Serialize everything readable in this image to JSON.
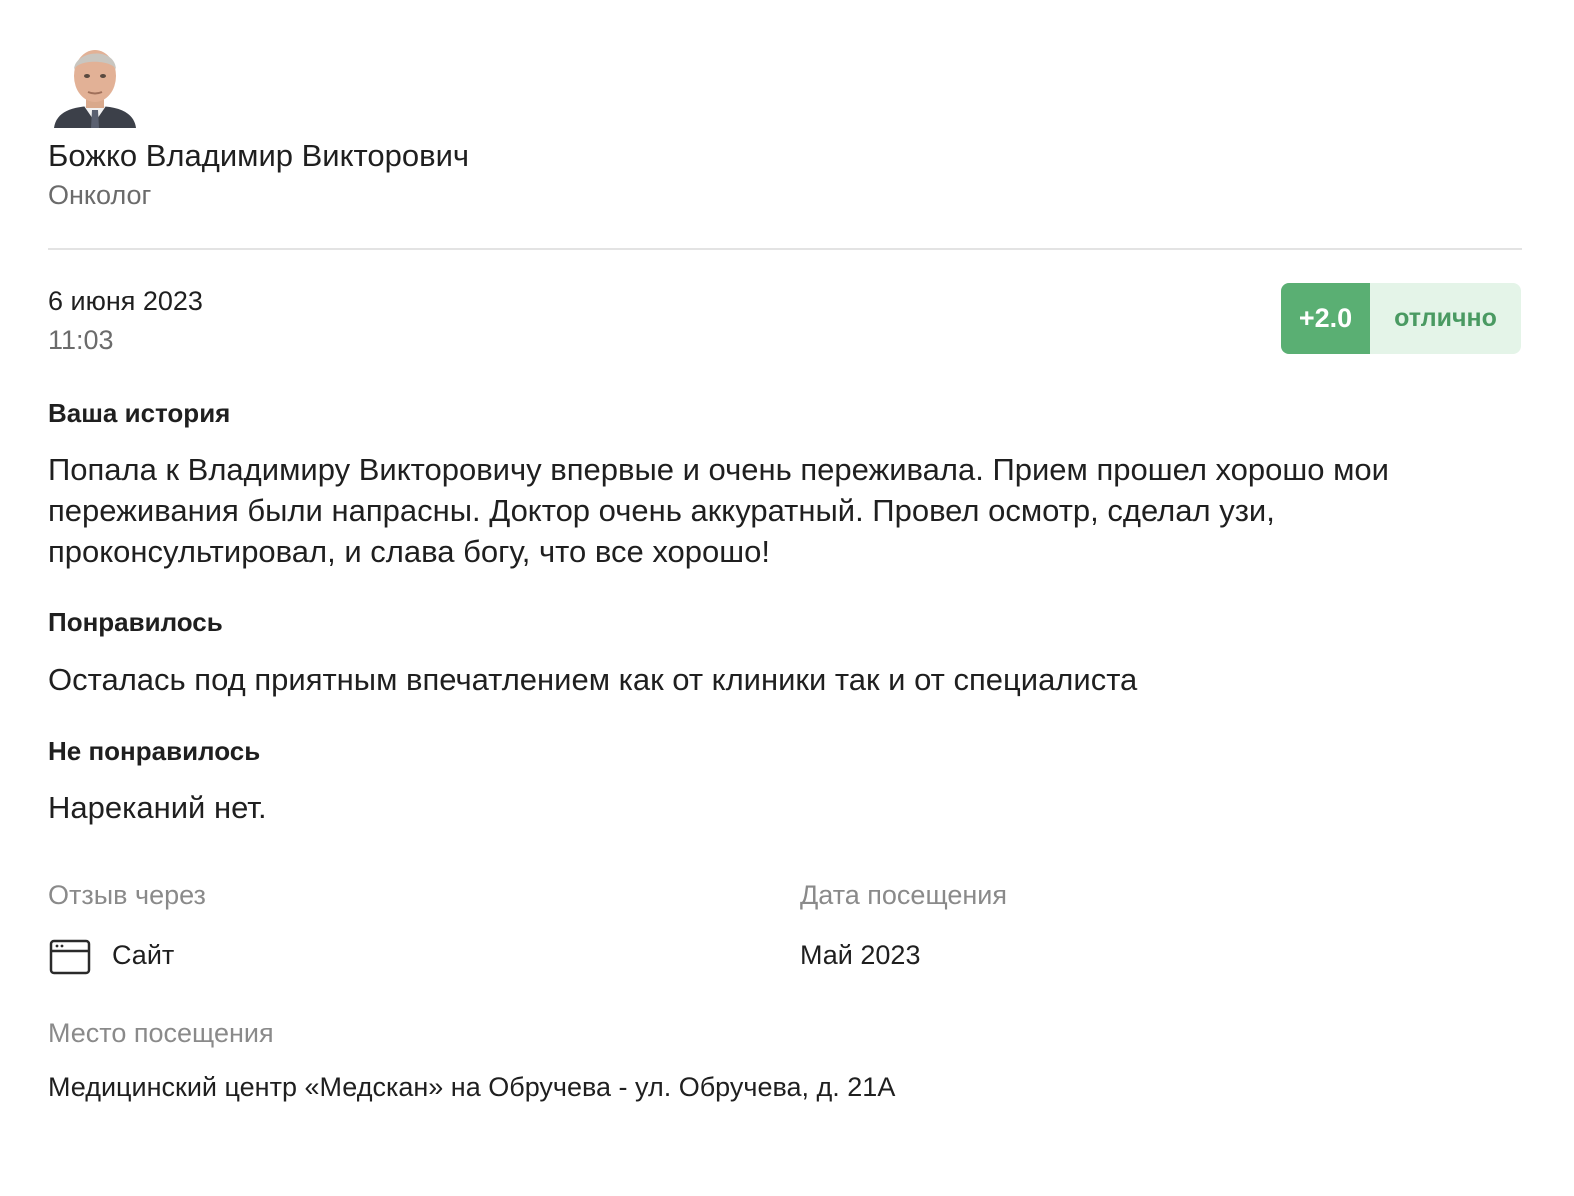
{
  "doctor": {
    "name": "Божко Владимир Викторович",
    "specialty": "Онколог"
  },
  "review": {
    "date": "6 июня 2023",
    "time": "11:03",
    "rating": {
      "score": "+2.0",
      "label": "отлично",
      "score_color": "#5aaf73",
      "label_bg": "#e4f4e8"
    },
    "sections": [
      {
        "title": "Ваша история",
        "text": "Попала к Владимиру Викторовичу впервые и очень переживала. Прием прошел хорошо мои переживания были напрасны. Доктор очень аккуратный. Провел осмотр, сделал узи, проконсультировал, и слава богу, что все хорошо!"
      },
      {
        "title": "Понравилось",
        "text": "Осталась под приятным впечатлением как от клиники так и от специалиста"
      },
      {
        "title": "Не понравилось",
        "text": "Нареканий нет."
      }
    ]
  },
  "meta": {
    "source_label": "Отзыв через",
    "source_value": "Сайт",
    "source_icon": "browser-window-icon",
    "visit_date_label": "Дата посещения",
    "visit_date_value": "Май 2023",
    "place_label": "Место посещения",
    "place_value": "Медицинский центр «Медскан» на Обручева - ул. Обручева, д. 21А"
  }
}
